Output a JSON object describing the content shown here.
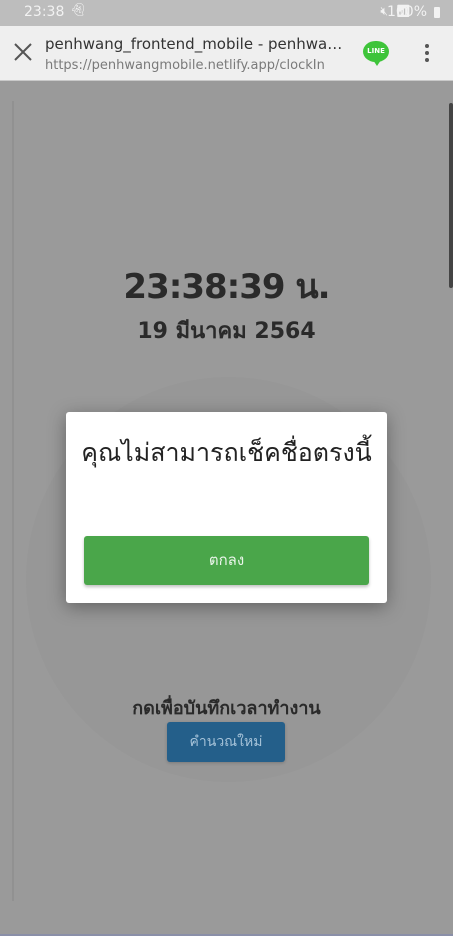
{
  "status_bar": {
    "time": "23:38",
    "notification_icon": "snapchat-ghost-icon",
    "signal_icons": "mute wifi signal signal",
    "battery": "100%"
  },
  "browser": {
    "title": "penhwang_frontend_mobile - penhwan...",
    "url": "https://penhwangmobile.netlify.app/clockIn",
    "line_icon_text": "LINE"
  },
  "page": {
    "clock": "23:38:39 น.",
    "date": "19 มีนาคม 2564",
    "press_label": "กดเพื่อบันทึกเวลาทำงาน",
    "recalculate_label": "คำนวณใหม่"
  },
  "modal": {
    "message": "คุณไม่สามารถเช็คชื่อตรงนี้",
    "ok_label": "ตกลง"
  },
  "colors": {
    "ok_button": "#4aa64a",
    "recalc_button": "#245f8a",
    "line_brand": "#3ec43a"
  }
}
